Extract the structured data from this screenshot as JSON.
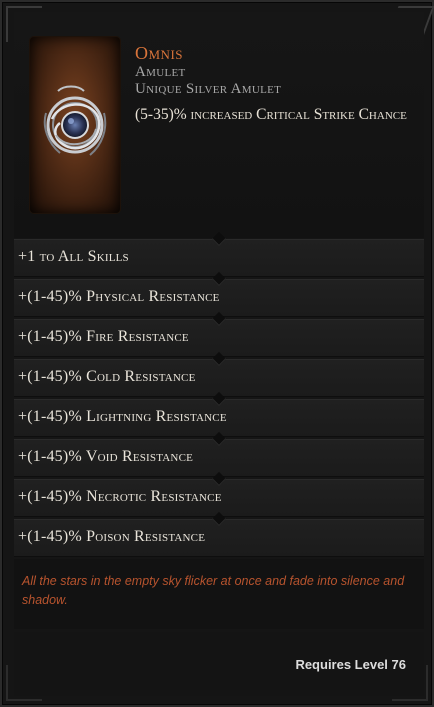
{
  "item": {
    "name": "Omnis",
    "base_type": "Amulet",
    "rarity_line": "Unique Silver Amulet",
    "implicit": "(5-35)% increased Critical Strike Chance",
    "icon": "silver-amulet-icon",
    "colors": {
      "unique_name": "#d9743a",
      "lore": "#b8542e",
      "affix_text": "#e9e4da",
      "subtitle": "#a8a8a8"
    }
  },
  "affixes": [
    "+1 to All Skills",
    "+(1-45)% Physical Resistance",
    "+(1-45)% Fire Resistance",
    "+(1-45)% Cold Resistance",
    "+(1-45)% Lightning Resistance",
    "+(1-45)% Void Resistance",
    "+(1-45)% Necrotic Resistance",
    "+(1-45)% Poison Resistance"
  ],
  "lore": "All the stars in the empty sky flicker at once and fade into silence and shadow.",
  "requirement": "Requires Level 76"
}
